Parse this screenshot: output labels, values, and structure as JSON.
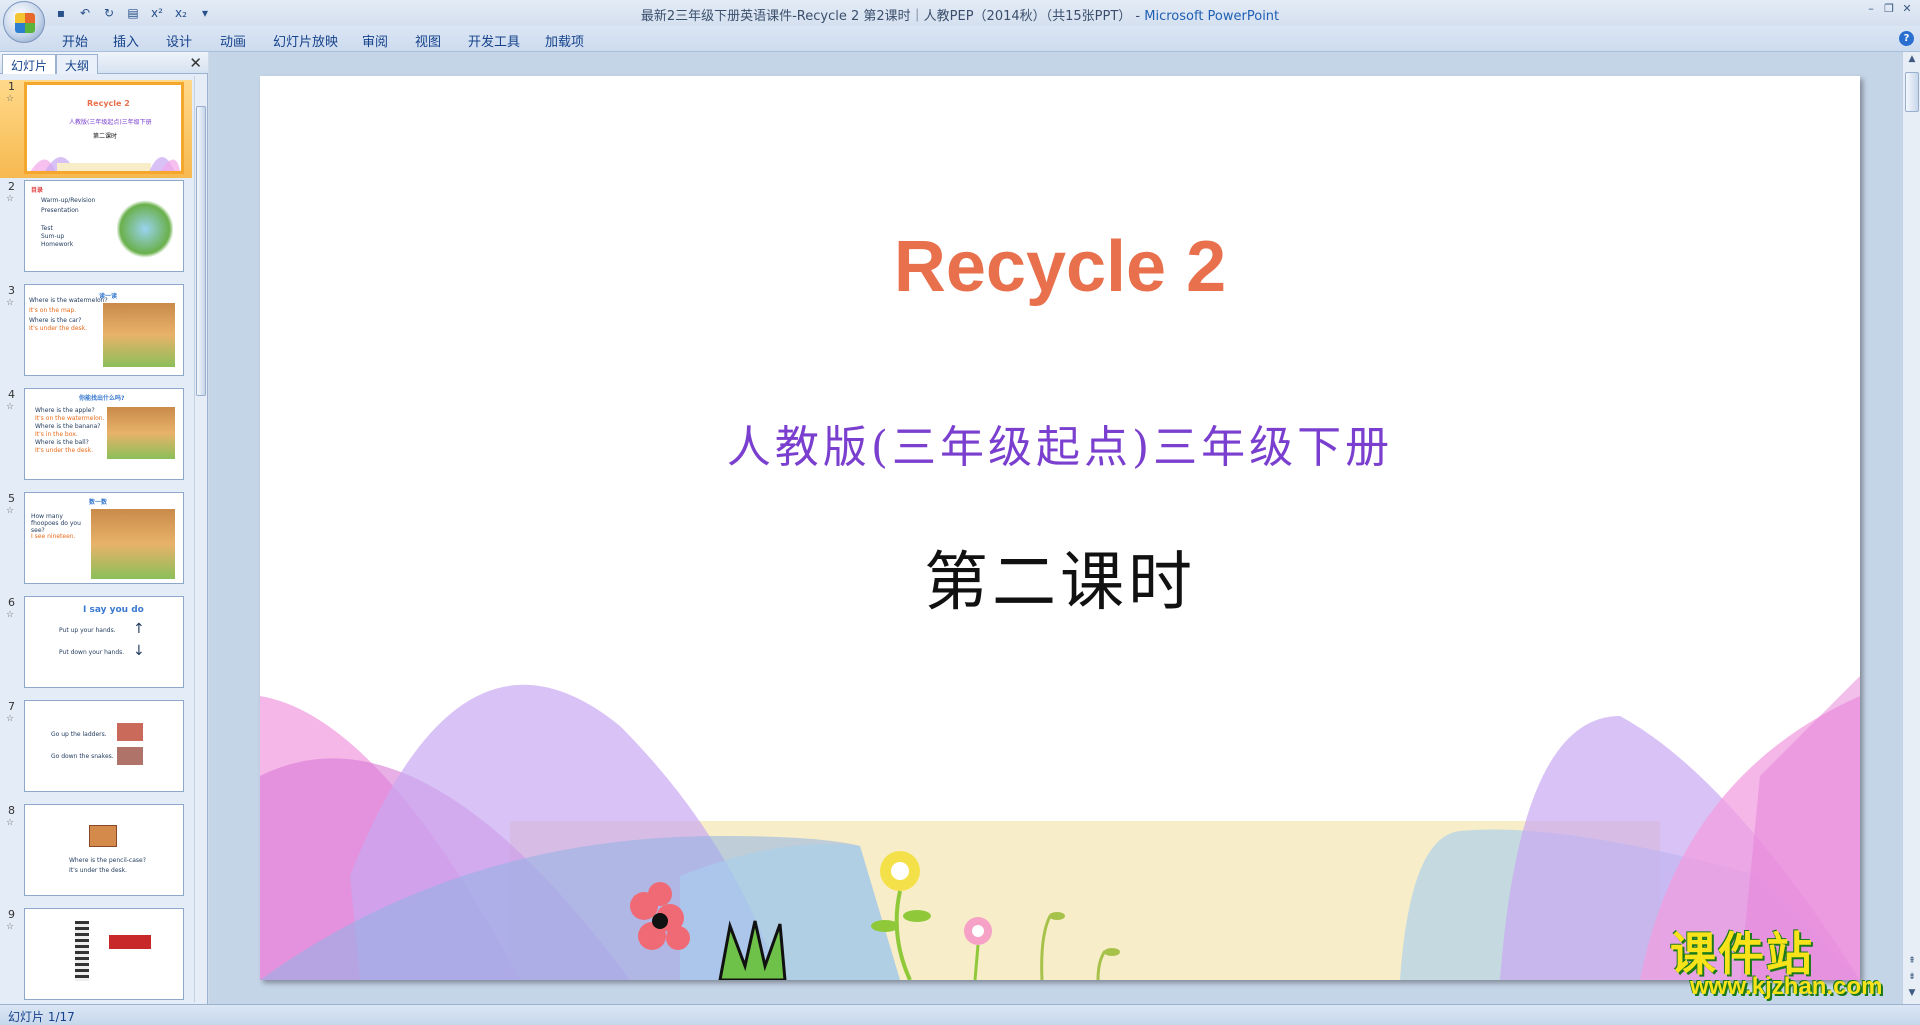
{
  "window": {
    "title": "最新2三年级下册英语课件-Recycle 2 第2课时｜人教PEP（2014秋）（共15张PPT）",
    "app_name": "Microsoft PowerPoint"
  },
  "ribbon": {
    "tabs": [
      "开始",
      "插入",
      "设计",
      "动画",
      "幻灯片放映",
      "审阅",
      "视图",
      "开发工具",
      "加载项"
    ]
  },
  "pane": {
    "tabs": [
      "幻灯片",
      "大纲"
    ]
  },
  "thumbnails": [
    {
      "num": "1",
      "lines": [
        "Recycle 2",
        "人教版(三年级起点)三年级下册",
        "第二课时"
      ]
    },
    {
      "num": "2",
      "lines": [
        "目录",
        "Warm-up/Revision",
        "Presentation",
        "Test",
        "Sum-up",
        "Homework"
      ]
    },
    {
      "num": "3",
      "lines": [
        "Where is the watermelon?",
        "It's on the map.",
        "Where is the car?",
        "It's under the desk.",
        "读一读"
      ]
    },
    {
      "num": "4",
      "lines": [
        "你能找出什么吗?",
        "Where is the apple?",
        "It's on the watermelon.",
        "Where is the banana?",
        "It's in the box.",
        "Where is the ball?",
        "It's under the desk."
      ]
    },
    {
      "num": "5",
      "lines": [
        "数一数",
        "How many fhoopoes do you see?",
        "I see nineteen."
      ]
    },
    {
      "num": "6",
      "lines": [
        "I say you do",
        "Put up your hands.",
        "Put down your hands."
      ]
    },
    {
      "num": "7",
      "lines": [
        "Go up the ladders.",
        "Go down the snakes."
      ]
    },
    {
      "num": "8",
      "lines": [
        "Where is the pencil-case?",
        "It's under the desk."
      ]
    },
    {
      "num": "9",
      "lines": []
    }
  ],
  "slide": {
    "title": "Recycle 2",
    "subtitle": "人教版(三年级起点)三年级下册",
    "lesson": "第二课时"
  },
  "status": {
    "slide_count": "幻灯片 1/17"
  },
  "watermark": {
    "text": "课件站",
    "url": "www.kjzhan.com"
  },
  "colors": {
    "title": "#e8704d",
    "subtitle": "#7a3fcf",
    "selection": "#f5a62c"
  }
}
